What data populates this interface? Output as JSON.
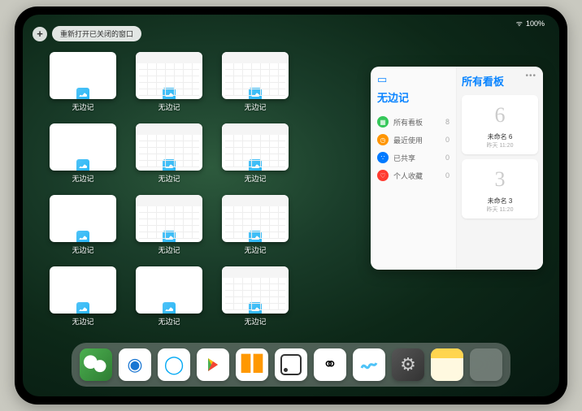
{
  "status": {
    "wifi": "wifi",
    "battery": "100%"
  },
  "topbar": {
    "plus": "+",
    "reopen": "重新打开已关闭的窗口"
  },
  "grid": {
    "label": "无边记"
  },
  "panel": {
    "icon": "▭",
    "dots": "•••",
    "title": "无边记",
    "title2": "所有看板",
    "rows": [
      {
        "icon": "▢",
        "label": "所有看板",
        "count": "8",
        "cls": "c1"
      },
      {
        "icon": "◷",
        "label": "最近使用",
        "count": "0",
        "cls": "c2"
      },
      {
        "icon": "⚉",
        "label": "已共享",
        "count": "0",
        "cls": "c3"
      },
      {
        "icon": "♡",
        "label": "个人收藏",
        "count": "0",
        "cls": "c4"
      }
    ],
    "cards": [
      {
        "sketch": "6",
        "label": "未命名 6",
        "date": "昨天 11:20"
      },
      {
        "sketch": "3",
        "label": "未命名 3",
        "date": "昨天 11:20"
      }
    ]
  },
  "thumbs": [
    "blank",
    "cal",
    "cal",
    "blank",
    "cal",
    "cal",
    "blank",
    "cal",
    "cal",
    "blank",
    "blank",
    "cal"
  ],
  "dock": [
    "WeChat",
    "Quark",
    "QQBrowser",
    "Play",
    "Books",
    "Dice",
    "Connect",
    "Freeform",
    "Settings",
    "Notes",
    "Folder"
  ]
}
